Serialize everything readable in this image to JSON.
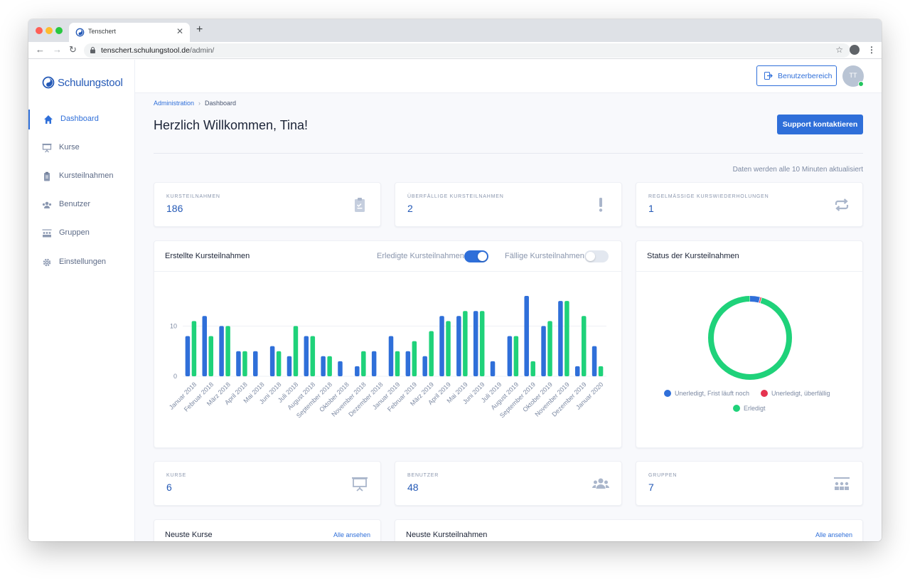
{
  "browser": {
    "tab_title": "Tenschert",
    "url_host": "tenschert.schulungstool.de",
    "url_path": "/admin/"
  },
  "sidebar": {
    "logo_text": "Schulungstool",
    "items": [
      {
        "label": "Dashboard",
        "icon": "home-icon",
        "active": true
      },
      {
        "label": "Kurse",
        "icon": "presentation-icon",
        "active": false
      },
      {
        "label": "Kursteilnahmen",
        "icon": "clipboard-icon",
        "active": false
      },
      {
        "label": "Benutzer",
        "icon": "users-icon",
        "active": false
      },
      {
        "label": "Gruppen",
        "icon": "groups-icon",
        "active": false
      },
      {
        "label": "Einstellungen",
        "icon": "gear-icon",
        "active": false
      }
    ]
  },
  "header": {
    "user_area_label": "Benutzerbereich",
    "avatar_initials": "TT"
  },
  "page": {
    "breadcrumb": [
      "Administration",
      "Dashboard"
    ],
    "title": "Herzlich Willkommen, Tina!",
    "support_label": "Support kontaktieren",
    "update_note": "Daten werden alle 10 Minuten aktualisiert"
  },
  "stats_top": [
    {
      "label": "Kursteilnahmen",
      "value": "186",
      "icon": "clipboard-icon"
    },
    {
      "label": "Überfällige Kursteilnahmen",
      "value": "2",
      "icon": "exclamation-icon"
    },
    {
      "label": "Regelmässige Kurswiederholungen",
      "value": "1",
      "icon": "repeat-icon"
    }
  ],
  "stats_bottom": [
    {
      "label": "Kurse",
      "value": "6",
      "icon": "presentation-icon"
    },
    {
      "label": "Benutzer",
      "value": "48",
      "icon": "users-icon"
    },
    {
      "label": "Gruppen",
      "value": "7",
      "icon": "groups-icon"
    }
  ],
  "bar_card": {
    "title": "Erstellte Kursteilnahmen",
    "toggle1_label": "Erledigte Kursteilnahmen",
    "toggle1_on": true,
    "toggle2_label": "Fällige Kursteilnahmen",
    "toggle2_on": false
  },
  "donut_card": {
    "title": "Status der Kursteilnahmen",
    "legend": [
      {
        "label": "Unerledigt, Frist läuft noch",
        "color": "#2f6fd9"
      },
      {
        "label": "Unerledigt, überfällig",
        "color": "#e5334f"
      },
      {
        "label": "Erledigt",
        "color": "#1fd27a"
      }
    ]
  },
  "recent": {
    "courses_title": "Neuste Kurse",
    "courses_link": "Alle ansehen",
    "enrollments_title": "Neuste Kursteilnahmen",
    "enrollments_link": "Alle ansehen"
  },
  "colors": {
    "accent": "#2f6fd9",
    "green": "#1fd27a",
    "red": "#e5334f"
  },
  "chart_data": [
    {
      "type": "bar",
      "title": "Erstellte Kursteilnahmen",
      "categories": [
        "Januar 2018",
        "Februar 2018",
        "März 2018",
        "April 2018",
        "Mai 2018",
        "Juni 2018",
        "Juli 2018",
        "August 2018",
        "September 2018",
        "Oktober 2018",
        "November 2018",
        "Dezember 2018",
        "Januar 2019",
        "Februar 2019",
        "März 2019",
        "April 2019",
        "Mai 2019",
        "Juni 2019",
        "Juli 2019",
        "August 2019",
        "September 2019",
        "Oktober 2019",
        "November 2019",
        "Dezember 2019",
        "Januar 2020"
      ],
      "series": [
        {
          "name": "",
          "color": "#2f6fd9",
          "values": [
            8,
            12,
            10,
            5,
            5,
            6,
            4,
            8,
            4,
            3,
            2,
            5,
            8,
            5,
            4,
            12,
            12,
            13,
            3,
            8,
            16,
            10,
            15,
            2,
            6
          ]
        },
        {
          "name": "Erledigte Kursteilnahmen",
          "color": "#1fd27a",
          "values": [
            11,
            8,
            10,
            5,
            0,
            5,
            10,
            8,
            4,
            0,
            5,
            0,
            5,
            7,
            9,
            11,
            13,
            13,
            0,
            8,
            3,
            11,
            15,
            12,
            2
          ]
        }
      ],
      "yticks": [
        0,
        10
      ],
      "ylim": [
        0,
        17
      ],
      "grid": true
    },
    {
      "type": "pie",
      "title": "Status der Kursteilnahmen",
      "labels": [
        "Unerledigt, Frist läuft noch",
        "Unerledigt, überfällig",
        "Erledigt"
      ],
      "values": [
        4,
        0.6,
        95.4
      ],
      "colors": [
        "#2f6fd9",
        "#e5334f",
        "#1fd27a"
      ],
      "donut": true
    }
  ]
}
